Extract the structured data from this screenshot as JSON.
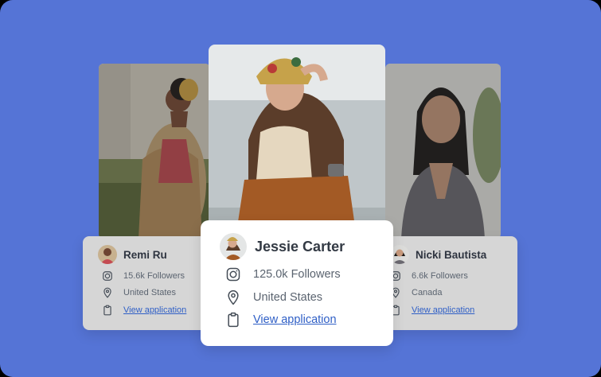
{
  "profiles": {
    "left": {
      "name": "Remi Ru",
      "followers": "15.6k Followers",
      "location": "United States",
      "link": "View application"
    },
    "center": {
      "name": "Jessie Carter",
      "followers": "125.0k Followers",
      "location": "United States",
      "link": "View application"
    },
    "right": {
      "name": "Nicki Bautista",
      "followers": "6.6k Followers",
      "location": "Canada",
      "link": "View application"
    }
  },
  "colors": {
    "background": "#5574d6",
    "card": "#ffffff",
    "side_card": "#d6d6d6",
    "link": "#2f5fc6"
  },
  "icons": {
    "followers": "instagram-icon",
    "location": "map-pin-icon",
    "application": "clipboard-icon"
  }
}
